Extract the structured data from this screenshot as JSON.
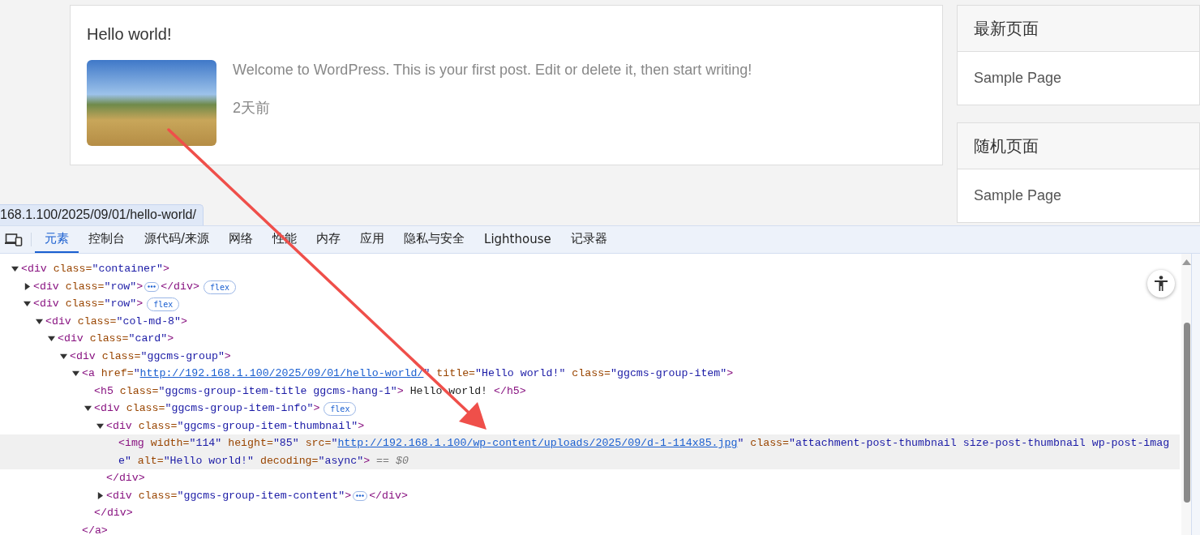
{
  "page": {
    "post": {
      "title": "Hello world!",
      "excerpt": "Welcome to WordPress. This is your first post. Edit or delete it, then start writing!",
      "date": "2天前"
    },
    "widgets": [
      {
        "title": "最新页面",
        "items": [
          "Sample Page"
        ]
      },
      {
        "title": "随机页面",
        "items": [
          "Sample Page"
        ]
      }
    ],
    "link_preview": "168.1.100/2025/09/01/hello-world/"
  },
  "devtools": {
    "tabs": [
      {
        "label": "元素",
        "selected": true
      },
      {
        "label": "控制台",
        "selected": false
      },
      {
        "label": "源代码/来源",
        "selected": false
      },
      {
        "label": "网络",
        "selected": false
      },
      {
        "label": "性能",
        "selected": false
      },
      {
        "label": "内存",
        "selected": false
      },
      {
        "label": "应用",
        "selected": false
      },
      {
        "label": "隐私与安全",
        "selected": false
      },
      {
        "label": "Lighthouse",
        "selected": false
      },
      {
        "label": "记录器",
        "selected": false
      }
    ],
    "tree": [
      {
        "expanded": true,
        "selected": false,
        "segments": [
          {
            "kind": "code",
            "tokens": [
              {
                "tag": "<div"
              },
              {
                "attr": " class="
              },
              {
                "value": "\"container\""
              },
              {
                "tag": ">"
              }
            ]
          }
        ],
        "children": [
          {
            "expanded": false,
            "selected": false,
            "segments": [
              {
                "kind": "code",
                "tokens": [
                  {
                    "tag": "<div"
                  },
                  {
                    "attr": " class="
                  },
                  {
                    "value": "\"row\""
                  },
                  {
                    "tag": ">"
                  }
                ]
              },
              {
                "kind": "ellipsis"
              },
              {
                "kind": "code",
                "tokens": [
                  {
                    "tag": "</div>"
                  }
                ]
              },
              {
                "kind": "badge",
                "text": "flex"
              }
            ]
          },
          {
            "expanded": true,
            "selected": false,
            "segments": [
              {
                "kind": "code",
                "tokens": [
                  {
                    "tag": "<div"
                  },
                  {
                    "attr": " class="
                  },
                  {
                    "value": "\"row\""
                  },
                  {
                    "tag": ">"
                  }
                ]
              },
              {
                "kind": "badge",
                "text": "flex"
              }
            ],
            "children": [
              {
                "expanded": true,
                "selected": false,
                "segments": [
                  {
                    "kind": "code",
                    "tokens": [
                      {
                        "tag": "<div"
                      },
                      {
                        "attr": " class="
                      },
                      {
                        "value": "\"col-md-8\""
                      },
                      {
                        "tag": ">"
                      }
                    ]
                  }
                ],
                "children": [
                  {
                    "expanded": true,
                    "selected": false,
                    "segments": [
                      {
                        "kind": "code",
                        "tokens": [
                          {
                            "tag": "<div"
                          },
                          {
                            "attr": " class="
                          },
                          {
                            "value": "\"card\""
                          },
                          {
                            "tag": ">"
                          }
                        ]
                      }
                    ],
                    "children": [
                      {
                        "expanded": true,
                        "selected": false,
                        "segments": [
                          {
                            "kind": "code",
                            "tokens": [
                              {
                                "tag": "<div"
                              },
                              {
                                "attr": " class="
                              },
                              {
                                "value": "\"ggcms-group\""
                              },
                              {
                                "tag": ">"
                              }
                            ]
                          }
                        ],
                        "children": [
                          {
                            "expanded": true,
                            "selected": false,
                            "segments": [
                              {
                                "kind": "code",
                                "tokens": [
                                  {
                                    "tag": "<a"
                                  },
                                  {
                                    "attr": " href="
                                  },
                                  {
                                    "value": "\""
                                  },
                                  {
                                    "link": "http://192.168.1.100/2025/09/01/hello-world/"
                                  },
                                  {
                                    "value": "\""
                                  },
                                  {
                                    "attr": " title="
                                  },
                                  {
                                    "value": "\"Hello world!\""
                                  },
                                  {
                                    "attr": " class="
                                  },
                                  {
                                    "value": "\"ggcms-group-item\""
                                  },
                                  {
                                    "tag": ">"
                                  }
                                ]
                              }
                            ],
                            "close": "</a>",
                            "children": [
                              {
                                "selected": false,
                                "segments": [
                                  {
                                    "kind": "code",
                                    "tokens": [
                                      {
                                        "tag": "<h5"
                                      },
                                      {
                                        "attr": " class="
                                      },
                                      {
                                        "value": "\"ggcms-group-item-title ggcms-hang-1\""
                                      },
                                      {
                                        "tag": ">"
                                      },
                                      {
                                        "text": " Hello world! "
                                      },
                                      {
                                        "tag": "</h5>"
                                      }
                                    ]
                                  }
                                ]
                              },
                              {
                                "expanded": true,
                                "selected": false,
                                "segments": [
                                  {
                                    "kind": "code",
                                    "tokens": [
                                      {
                                        "tag": "<div"
                                      },
                                      {
                                        "attr": " class="
                                      },
                                      {
                                        "value": "\"ggcms-group-item-info\""
                                      },
                                      {
                                        "tag": ">"
                                      }
                                    ]
                                  },
                                  {
                                    "kind": "badge",
                                    "text": "flex"
                                  }
                                ],
                                "close": "</div>",
                                "children": [
                                  {
                                    "expanded": true,
                                    "selected": false,
                                    "segments": [
                                      {
                                        "kind": "code",
                                        "tokens": [
                                          {
                                            "tag": "<div"
                                          },
                                          {
                                            "attr": " class="
                                          },
                                          {
                                            "value": "\"ggcms-group-item-thumbnail\""
                                          },
                                          {
                                            "tag": ">"
                                          }
                                        ]
                                      }
                                    ],
                                    "close": "</div>",
                                    "children": [
                                      {
                                        "selected": true,
                                        "segments": [
                                          {
                                            "kind": "code",
                                            "tokens": [
                                              {
                                                "tag": "<img"
                                              },
                                              {
                                                "attr": " width="
                                              },
                                              {
                                                "value": "\"114\""
                                              },
                                              {
                                                "attr": " height="
                                              },
                                              {
                                                "value": "\"85\""
                                              },
                                              {
                                                "attr": " src="
                                              },
                                              {
                                                "value": "\""
                                              },
                                              {
                                                "link": "http://192.168.1.100/wp-content/uploads/2025/09/d-1-114x85.jpg"
                                              },
                                              {
                                                "value": "\""
                                              },
                                              {
                                                "attr": " class="
                                              },
                                              {
                                                "value": "\"attachment-post-thumbnail size-post-thumbnail wp-post-image\""
                                              },
                                              {
                                                "attr": " alt="
                                              },
                                              {
                                                "value": "\"Hello world!\""
                                              },
                                              {
                                                "attr": " decoding="
                                              },
                                              {
                                                "value": "\"async\""
                                              },
                                              {
                                                "tag": ">"
                                              },
                                              {
                                                "note": " == $0"
                                              }
                                            ]
                                          }
                                        ]
                                      }
                                    ]
                                  },
                                  {
                                    "expanded": false,
                                    "selected": false,
                                    "segments": [
                                      {
                                        "kind": "code",
                                        "tokens": [
                                          {
                                            "tag": "<div"
                                          },
                                          {
                                            "attr": " class="
                                          },
                                          {
                                            "value": "\"ggcms-group-item-content\""
                                          },
                                          {
                                            "tag": ">"
                                          }
                                        ]
                                      },
                                      {
                                        "kind": "ellipsis"
                                      },
                                      {
                                        "kind": "code",
                                        "tokens": [
                                          {
                                            "tag": "</div>"
                                          }
                                        ]
                                      }
                                    ]
                                  }
                                ]
                              }
                            ]
                          }
                        ]
                      }
                    ]
                  }
                ]
              }
            ]
          }
        ]
      }
    ]
  }
}
